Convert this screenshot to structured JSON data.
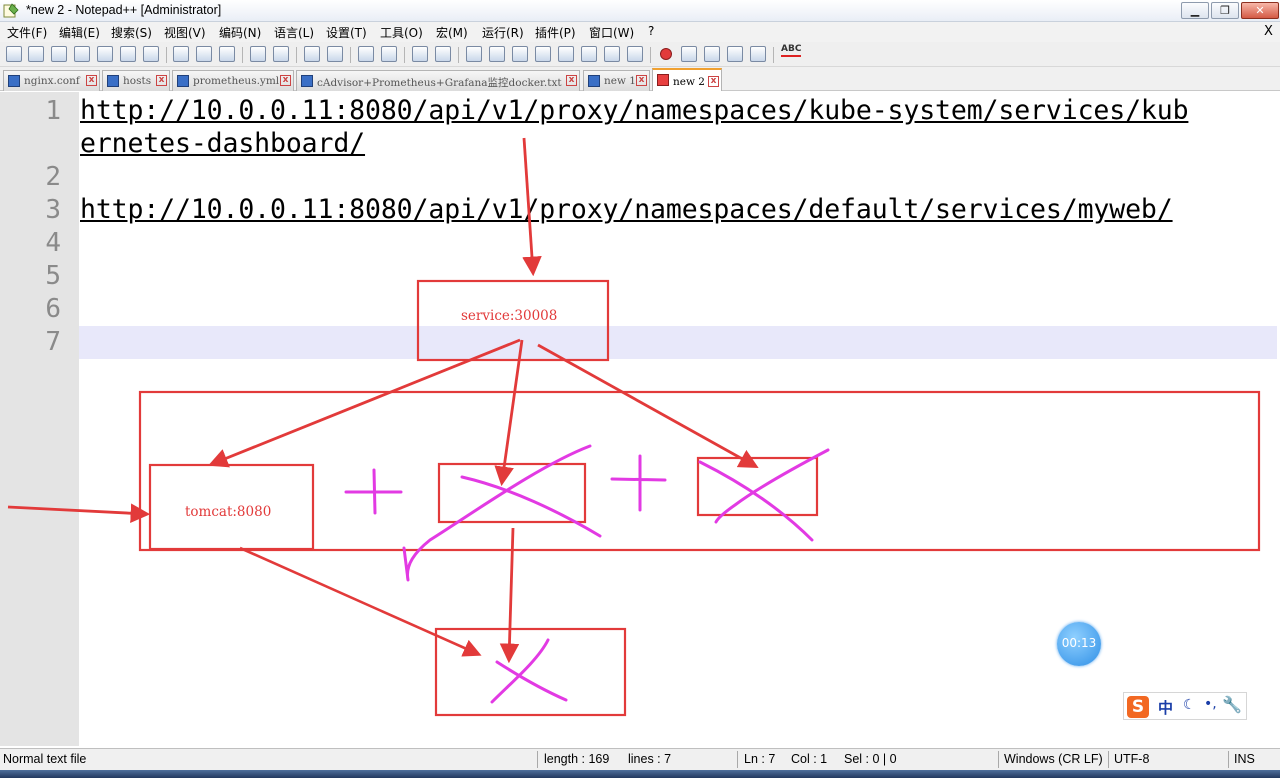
{
  "window": {
    "title": "*new 2 - Notepad++ [Administrator]",
    "min_glyph": "▁",
    "max_glyph": "❐",
    "close_glyph": "✕"
  },
  "menu": {
    "items": [
      "文件(F)",
      "编辑(E)",
      "搜索(S)",
      "视图(V)",
      "编码(N)",
      "语言(L)",
      "设置(T)",
      "工具(O)",
      "宏(M)",
      "运行(R)",
      "插件(P)",
      "窗口(W)",
      "?"
    ],
    "close_label": "X"
  },
  "toolbar": {
    "spell_label": "ABC"
  },
  "tabs": [
    {
      "label": "nginx.conf",
      "active": false
    },
    {
      "label": "hosts",
      "active": false
    },
    {
      "label": "prometheus.yml",
      "active": false
    },
    {
      "label": "cAdvisor+Prometheus+Grafana监控docker.txt",
      "active": false
    },
    {
      "label": "new 1",
      "active": false
    },
    {
      "label": "new 2",
      "active": true
    }
  ],
  "editor": {
    "line_numbers": [
      "1",
      "2",
      "3",
      "4",
      "5",
      "6",
      "7"
    ],
    "lines": {
      "line1_part1": "http://10.0.0.11:8080/api/v1/proxy/namespaces/kube-system/services/kub",
      "line1_part2": "ernetes-dashboard/",
      "line3": "http://10.0.0.11:8080/api/v1/proxy/namespaces/default/services/myweb/"
    },
    "current_line": 7
  },
  "annotations": {
    "service_label": "service:30008",
    "tomcat_label": "tomcat:8080",
    "accent_color": "#e23a3a",
    "pen_color": "#e23ae3"
  },
  "timer": {
    "value": "00:13"
  },
  "ime": {
    "logo": "S",
    "lang": "中",
    "moon": "☾",
    "punct": "•,",
    "tool": "🔧"
  },
  "status": {
    "file_type": "Normal text file",
    "length": "length : 169",
    "lines": "lines : 7",
    "ln": "Ln : 7",
    "col": "Col : 1",
    "sel": "Sel : 0 | 0",
    "eol": "Windows (CR LF)",
    "encoding": "UTF-8",
    "mode": "INS"
  }
}
